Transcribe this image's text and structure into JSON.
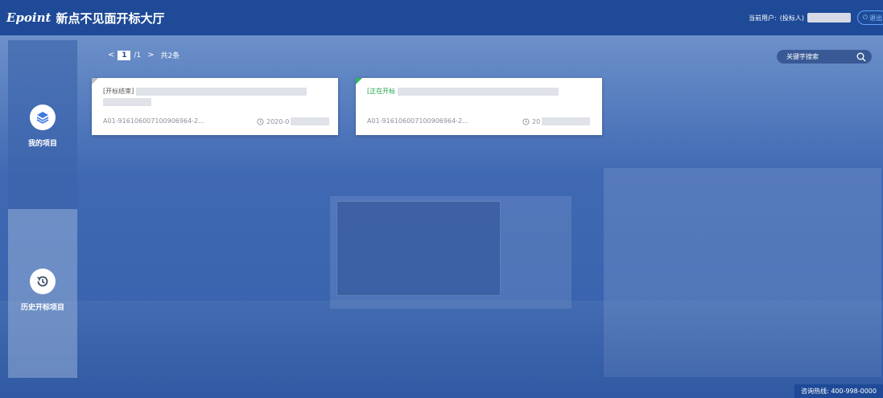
{
  "header": {
    "logo": "Epoint",
    "title": "新点不见面开标大厅",
    "user_label": "当前用户:",
    "user_role": "(投标人)",
    "logout_label": "退出"
  },
  "sidebar": {
    "items": [
      {
        "label": "我的项目",
        "icon": "layers-icon"
      },
      {
        "label": "历史开标项目",
        "icon": "history-icon"
      }
    ]
  },
  "pager": {
    "prev": "<",
    "current": "1",
    "total": "/1",
    "next": ">",
    "count": "共2条"
  },
  "search": {
    "placeholder": "关键字搜索",
    "icon": "search-icon"
  },
  "cards": [
    {
      "status": "[开标结束]",
      "code": "A01-916106007100906964-2...",
      "date": "2020-0"
    },
    {
      "status": "[正在开标",
      "code": "A01-916106007100906964-2...",
      "date": "20"
    }
  ],
  "footer": {
    "hotline": "咨询热线: 400-998-0000"
  },
  "colors": {
    "header_bg": "#1e4a97",
    "scene_overlay": "#3560ab",
    "status_active": "#1fa24a",
    "status_ended": "#555555"
  }
}
